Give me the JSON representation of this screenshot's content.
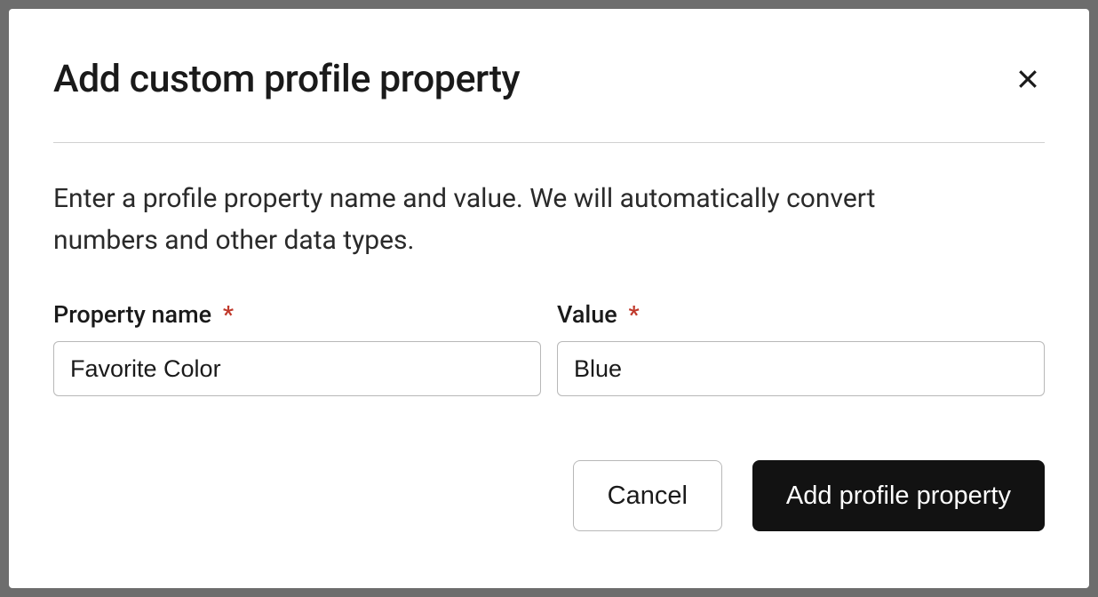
{
  "modal": {
    "title": "Add custom profile property",
    "description": "Enter a profile property name and value. We will automatically convert numbers and other data types.",
    "fields": {
      "propertyName": {
        "label": "Property name",
        "value": "Favorite Color",
        "required": true
      },
      "value": {
        "label": "Value",
        "value": "Blue",
        "required": true
      }
    },
    "buttons": {
      "cancel": "Cancel",
      "submit": "Add profile property"
    },
    "requiredMark": "*"
  }
}
